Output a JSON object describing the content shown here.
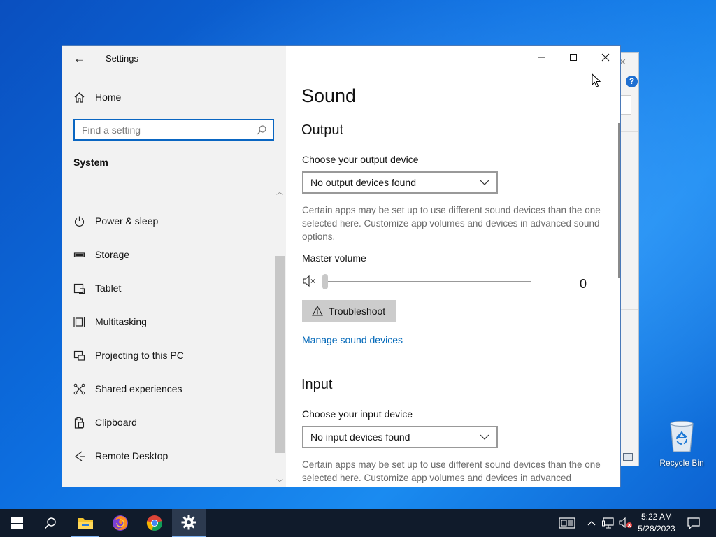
{
  "window": {
    "app_title": "Settings",
    "minimize_label": "Minimize",
    "maximize_label": "Maximize",
    "close_label": "Close"
  },
  "sidebar": {
    "home_label": "Home",
    "search_placeholder": "Find a setting",
    "section_title": "System",
    "items": [
      {
        "label": "Power & sleep",
        "icon": "power-icon"
      },
      {
        "label": "Storage",
        "icon": "storage-icon"
      },
      {
        "label": "Tablet",
        "icon": "tablet-icon"
      },
      {
        "label": "Multitasking",
        "icon": "multitasking-icon"
      },
      {
        "label": "Projecting to this PC",
        "icon": "projecting-icon"
      },
      {
        "label": "Shared experiences",
        "icon": "shared-experiences-icon"
      },
      {
        "label": "Clipboard",
        "icon": "clipboard-icon"
      },
      {
        "label": "Remote Desktop",
        "icon": "remote-desktop-icon"
      }
    ]
  },
  "main": {
    "title": "Sound",
    "output": {
      "heading": "Output",
      "device_label": "Choose your output device",
      "device_value": "No output devices found",
      "description": "Certain apps may be set up to use different sound devices than the one selected here. Customize app volumes and devices in advanced sound options.",
      "volume_label": "Master volume",
      "volume_value": "0",
      "volume_level": 0,
      "troubleshoot_label": "Troubleshoot",
      "manage_link": "Manage sound devices"
    },
    "input": {
      "heading": "Input",
      "device_label": "Choose your input device",
      "device_value": "No input devices found",
      "description": "Certain apps may be set up to use different sound devices than the one selected here. Customize app volumes and devices in advanced"
    }
  },
  "desktop": {
    "recycle_bin_label": "Recycle Bin"
  },
  "taskbar": {
    "apps": [
      "start-icon",
      "search-icon",
      "file-explorer-icon",
      "firefox-icon",
      "chrome-icon",
      "settings-icon"
    ],
    "active_app": "settings-icon",
    "time": "5:22 AM",
    "date": "5/28/2023"
  },
  "colors": {
    "accent": "#0067b8",
    "search_border": "#0a66c2",
    "taskbar": "#101b2b",
    "sidebar_bg": "#f2f2f2"
  }
}
